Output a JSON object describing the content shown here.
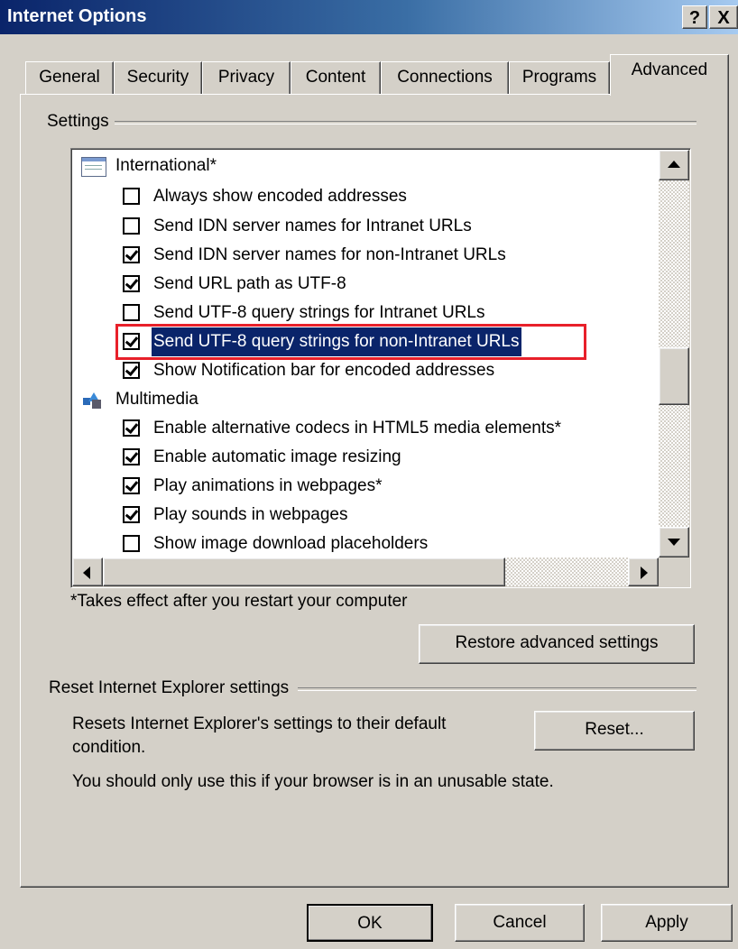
{
  "window": {
    "title": "Internet Options",
    "help_glyph": "?",
    "close_glyph": "X"
  },
  "tabs": [
    {
      "label": "General"
    },
    {
      "label": "Security"
    },
    {
      "label": "Privacy"
    },
    {
      "label": "Content"
    },
    {
      "label": "Connections"
    },
    {
      "label": "Programs"
    },
    {
      "label": "Advanced",
      "active": true
    }
  ],
  "settings": {
    "group_label": "Settings",
    "categories": {
      "international": {
        "label": "International*",
        "items": [
          {
            "label": "Always show encoded addresses",
            "checked": false
          },
          {
            "label": "Send IDN server names for Intranet URLs",
            "checked": false
          },
          {
            "label": "Send IDN server names for non-Intranet URLs",
            "checked": true
          },
          {
            "label": "Send URL path as UTF-8",
            "checked": true
          },
          {
            "label": "Send UTF-8 query strings for Intranet URLs",
            "checked": false
          },
          {
            "label": "Send UTF-8 query strings for non-Intranet URLs",
            "checked": true,
            "selected": true
          },
          {
            "label": "Show Notification bar for encoded addresses",
            "checked": true
          }
        ]
      },
      "multimedia": {
        "label": "Multimedia",
        "items": [
          {
            "label": "Enable alternative codecs in HTML5 media elements*",
            "checked": true
          },
          {
            "label": "Enable automatic image resizing",
            "checked": true
          },
          {
            "label": "Play animations in webpages*",
            "checked": true
          },
          {
            "label": "Play sounds in webpages",
            "checked": true
          },
          {
            "label": "Show image download placeholders",
            "checked": false
          }
        ]
      }
    },
    "note": "*Takes effect after you restart your computer",
    "restore_button": "Restore advanced settings"
  },
  "reset": {
    "group_label": "Reset Internet Explorer settings",
    "description": "Resets Internet Explorer's settings to their default condition.",
    "button": "Reset...",
    "warning": "You should only use this if your browser is in an unusable state."
  },
  "footer": {
    "ok": "OK",
    "cancel": "Cancel",
    "apply": "Apply"
  },
  "colors": {
    "title_bar": "#0a246a",
    "selection": "#0a246a",
    "annotation_box": "#e8202a",
    "dialog_bg": "#d4d0c8"
  }
}
